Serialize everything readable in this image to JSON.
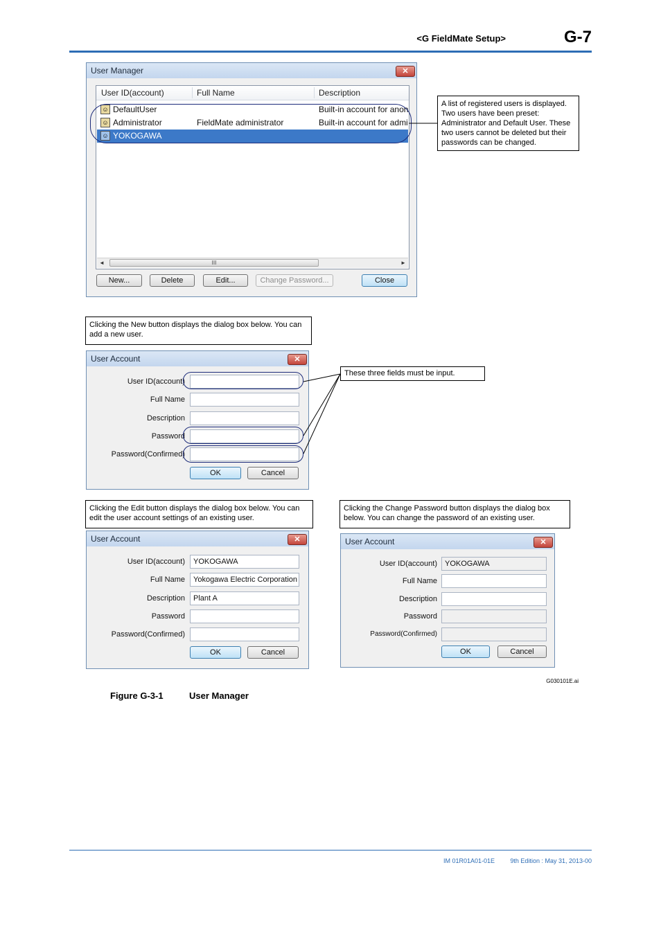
{
  "header": {
    "section": "<G  FieldMate Setup>",
    "page": "G-7"
  },
  "user_manager": {
    "title": "User Manager",
    "close_glyph": "✕",
    "columns": [
      "User ID(account)",
      "Full Name",
      "Description"
    ],
    "rows": [
      {
        "id": "DefaultUser",
        "full_name": "",
        "description": "Built-in account for anonymous"
      },
      {
        "id": "Administrator",
        "full_name": "FieldMate administrator",
        "description": "Built-in account for administrator"
      },
      {
        "id": "YOKOGAWA",
        "full_name": "",
        "description": ""
      }
    ],
    "scroll_grip": "III",
    "buttons": {
      "new": "New...",
      "delete": "Delete",
      "edit": "Edit...",
      "change_password": "Change Password...",
      "close": "Close"
    }
  },
  "callouts": {
    "list": "A list of registered users is displayed. Two users have been preset: Administrator and Default User. These two users cannot be deleted but their passwords can be changed.",
    "new": "Clicking the New button displays the dialog box below. You can add a new user.",
    "required": "These three fields must be input.",
    "edit": "Clicking the Edit button displays the dialog box below. You can edit the user account settings of an existing user.",
    "change_password": "Clicking the Change Password button displays the dialog box below. You can change the password of an existing user."
  },
  "user_account": {
    "title": "User Account",
    "labels": [
      "User ID(account)",
      "Full Name",
      "Description",
      "Password",
      "Password(Confirmed)"
    ],
    "ok": "OK",
    "cancel": "Cancel",
    "edit_values": {
      "user_id": "YOKOGAWA",
      "full_name": "Yokogawa Electric Corporation",
      "description": "Plant A"
    },
    "change_password_values": {
      "user_id": "YOKOGAWA"
    }
  },
  "figure": {
    "number": "Figure G-3-1",
    "title": "User Manager",
    "file": "G030101E.ai"
  },
  "footer": {
    "doc": "IM 01R01A01-01E",
    "edition": "9th Edition : May 31, 2013-00"
  },
  "colors": {
    "accent": "#2d6db5",
    "selection": "#3c79c8",
    "oval": "#1c2b7a"
  }
}
